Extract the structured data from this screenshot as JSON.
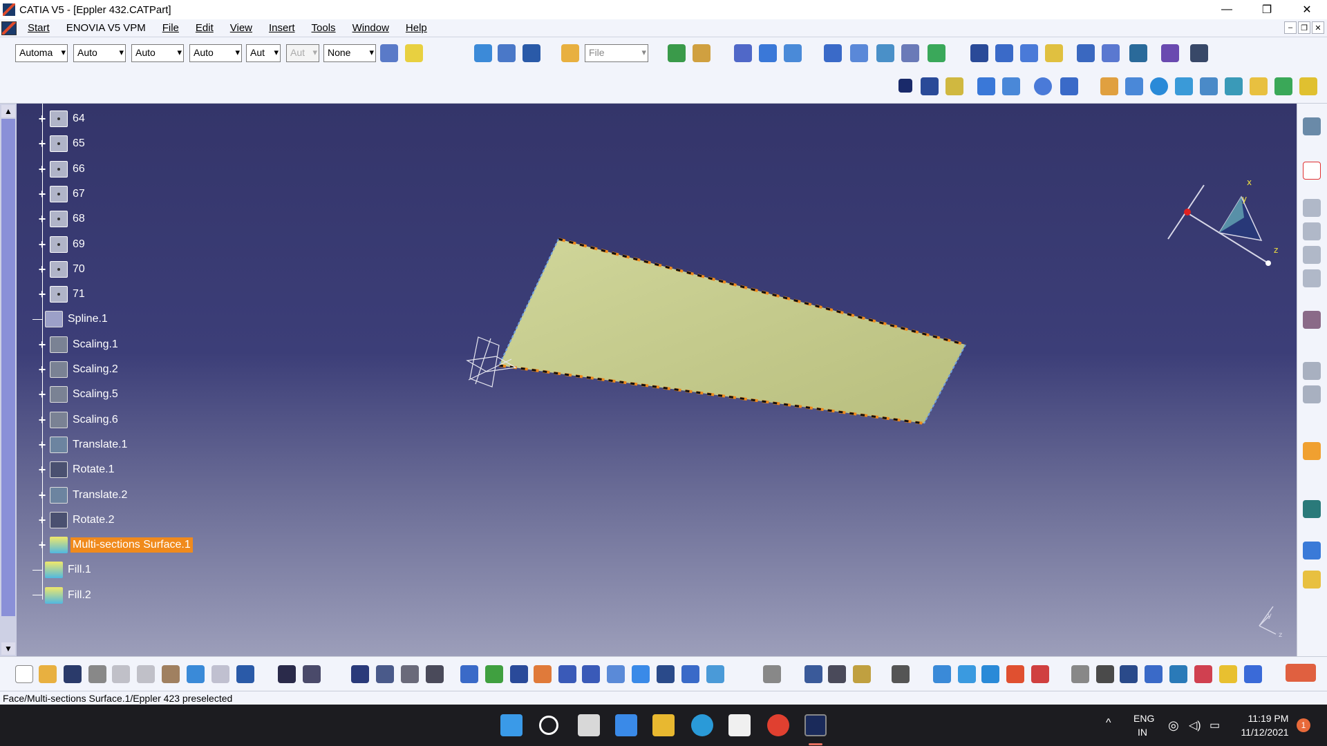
{
  "window": {
    "title": "CATIA V5 - [Eppler 432.CATPart]"
  },
  "window_controls": {
    "minimize": "—",
    "restore": "❐",
    "close": "✕"
  },
  "mdi_controls": {
    "minimize": "–",
    "restore": "❐",
    "close": "✕"
  },
  "menu": {
    "items": [
      "Start",
      "ENOVIA V5 VPM",
      "File",
      "Edit",
      "View",
      "Insert",
      "Tools",
      "Window",
      "Help"
    ]
  },
  "toolbar": {
    "combos": [
      "Automa",
      "Auto",
      "Auto",
      "Auto",
      "Aut",
      "Aut",
      "None"
    ],
    "file_combo": "File"
  },
  "tree": {
    "items": [
      {
        "label": "64",
        "icon": "point-icon"
      },
      {
        "label": "65",
        "icon": "point-icon"
      },
      {
        "label": "66",
        "icon": "point-icon"
      },
      {
        "label": "67",
        "icon": "point-icon"
      },
      {
        "label": "68",
        "icon": "point-icon"
      },
      {
        "label": "69",
        "icon": "point-icon"
      },
      {
        "label": "70",
        "icon": "point-icon"
      },
      {
        "label": "71",
        "icon": "point-icon"
      },
      {
        "label": "Spline.1",
        "icon": "spline-icon"
      },
      {
        "label": "Scaling.1",
        "icon": "scaling-icon"
      },
      {
        "label": "Scaling.2",
        "icon": "scaling-icon"
      },
      {
        "label": "Scaling.5",
        "icon": "scaling-icon"
      },
      {
        "label": "Scaling.6",
        "icon": "scaling-icon"
      },
      {
        "label": "Translate.1",
        "icon": "translate-icon"
      },
      {
        "label": "Rotate.1",
        "icon": "rotate-icon"
      },
      {
        "label": "Translate.2",
        "icon": "translate-icon"
      },
      {
        "label": "Rotate.2",
        "icon": "rotate-icon"
      },
      {
        "label": "Multi-sections Surface.1",
        "icon": "surface-icon",
        "selected": true
      },
      {
        "label": "Fill.1",
        "icon": "surface-icon"
      },
      {
        "label": "Fill.2",
        "icon": "surface-icon"
      }
    ]
  },
  "compass": {
    "x_label": "x",
    "y_label": "y",
    "z_label": "z"
  },
  "axis_indicator": {
    "y_label": "y",
    "z_label": "z"
  },
  "status": {
    "text": "Face/Multi-sections Surface.1/Eppler 423 preselected"
  },
  "tray": {
    "lang_line1": "ENG",
    "lang_line2": "IN",
    "time": "11:19 PM",
    "date": "11/12/2021",
    "notifications": "1"
  },
  "colors": {
    "selection": "#f08a1c",
    "surface": "#c2c88a",
    "viewport_top": "#34356a"
  }
}
